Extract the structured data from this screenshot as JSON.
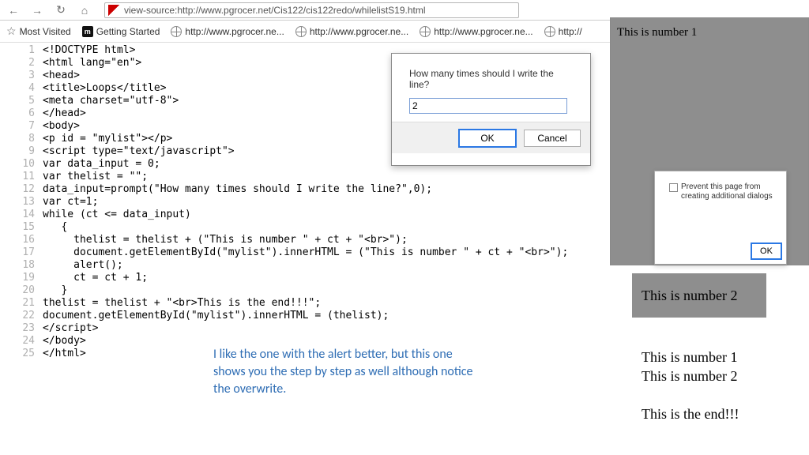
{
  "browser": {
    "url": "view-source:http://www.pgrocer.net/Cis122/cis122redo/whilelistS19.html",
    "bookmarks": {
      "most_visited": "Most Visited",
      "getting_started": "Getting Started",
      "bk1": "http://www.pgrocer.ne...",
      "bk2": "http://www.pgrocer.ne...",
      "bk3": "http://www.pgrocer.ne...",
      "bk4": "http://"
    }
  },
  "code": {
    "lines": [
      "<!DOCTYPE html>",
      "<html lang=\"en\">",
      "<head>",
      "<title>Loops</title>",
      "<meta charset=\"utf-8\">",
      "</head>",
      "<body>",
      "<p id = \"mylist\"></p>",
      "<script type=\"text/javascript\">",
      "var data_input = 0;",
      "var thelist = \"\";",
      "data_input=prompt(\"How many times should I write the line?\",0);",
      "var ct=1;",
      "while (ct <= data_input)",
      "   {",
      "     thelist = thelist + (\"This is number \" + ct + \"<br>\");",
      "     document.getElementById(\"mylist\").innerHTML = (\"This is number \" + ct + \"<br>\");",
      "     alert();",
      "     ct = ct + 1;",
      "   }",
      "thelist = thelist + \"<br>This is the end!!!\";",
      "document.getElementById(\"mylist\").innerHTML = (thelist);",
      "</script>",
      "</body>",
      "</html>"
    ]
  },
  "prompt_dialog": {
    "question": "How many times should I write the line?",
    "input_value": "2",
    "ok": "OK",
    "cancel": "Cancel"
  },
  "alert1": {
    "text": "This is number 1",
    "checkbox_label": "Prevent this page from creating additional dialogs",
    "ok": "OK"
  },
  "alert2": {
    "text": "This is number 2"
  },
  "output": {
    "line1": "This is number 1",
    "line2": "This is number 2",
    "end": "This is the end!!!"
  },
  "annotation": "I like the one with the alert better, but this one shows you the step by step as well although notice the overwrite."
}
